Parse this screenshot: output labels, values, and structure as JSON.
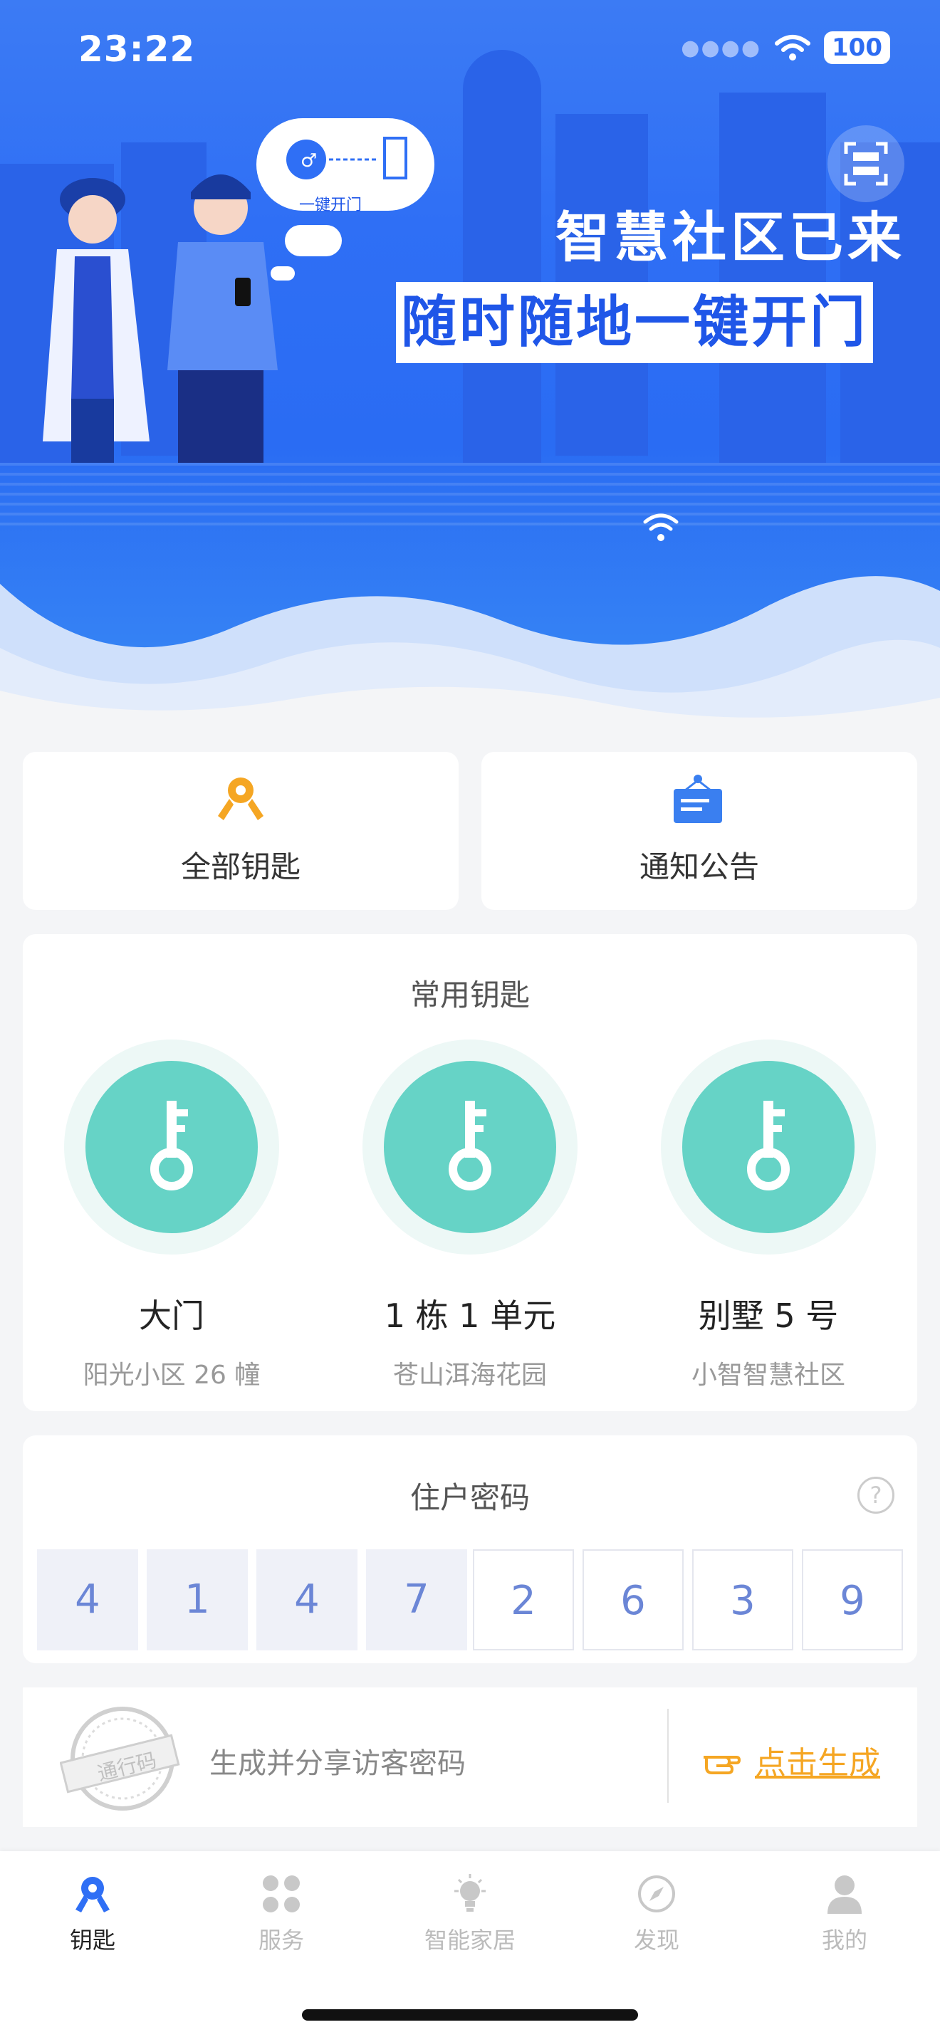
{
  "status_bar": {
    "time": "23:22",
    "battery": "100"
  },
  "banner": {
    "title": "智慧社区已来",
    "subtitle": "随时随地一键开门",
    "bubble_label": "一键开门"
  },
  "quick_actions": [
    {
      "label": "全部钥匙",
      "icon": "keys-icon"
    },
    {
      "label": "通知公告",
      "icon": "notice-board-icon"
    }
  ],
  "common_keys": {
    "title": "常用钥匙",
    "items": [
      {
        "name": "大门",
        "location": "阳光小区 26 幢"
      },
      {
        "name": "1 栋 1 单元",
        "location": "苍山洱海花园"
      },
      {
        "name": "别墅 5 号",
        "location": "小智智慧社区"
      }
    ]
  },
  "resident_password": {
    "title": "住户密码",
    "digits": [
      "4",
      "1",
      "4",
      "7",
      "2",
      "6",
      "3",
      "9"
    ]
  },
  "visitor": {
    "stamp_text": "通行码",
    "description": "生成并分享访客密码",
    "action_label": "点击生成"
  },
  "tabbar": {
    "items": [
      {
        "label": "钥匙",
        "icon": "key-tab-icon",
        "active": true
      },
      {
        "label": "服务",
        "icon": "grid-tab-icon",
        "active": false
      },
      {
        "label": "智能家居",
        "icon": "bulb-tab-icon",
        "active": false
      },
      {
        "label": "发现",
        "icon": "compass-tab-icon",
        "active": false
      },
      {
        "label": "我的",
        "icon": "user-tab-icon",
        "active": false
      }
    ]
  },
  "colors": {
    "primary": "#2f6ff5",
    "key_green": "#66d3c6",
    "accent_orange": "#f5a623",
    "tab_active": "#222222",
    "tab_inactive": "#bbbbbb"
  }
}
